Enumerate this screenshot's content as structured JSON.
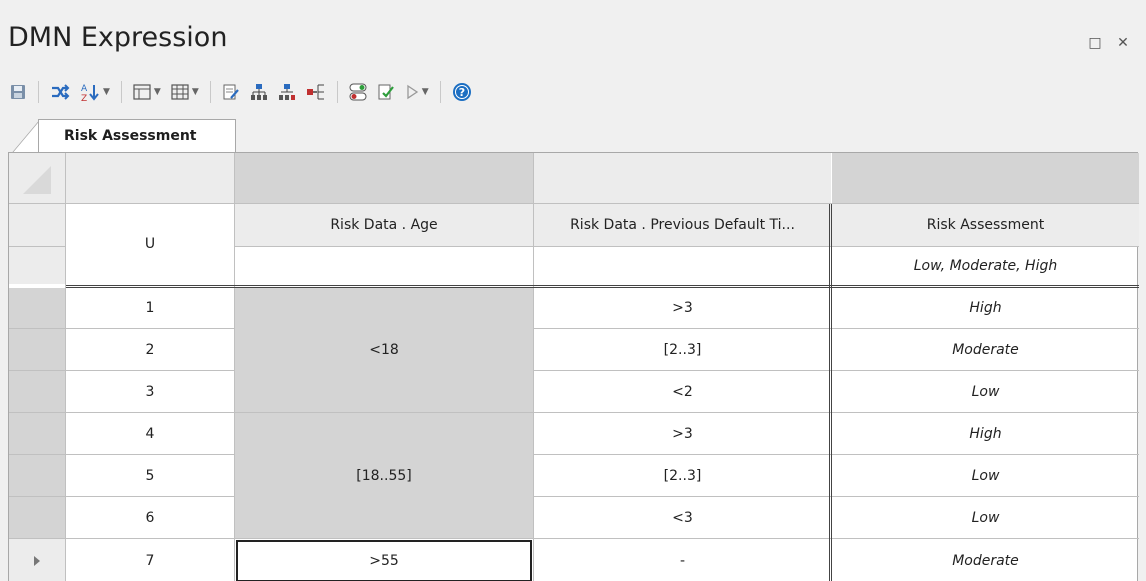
{
  "window": {
    "title": "DMN Expression"
  },
  "toolbar": {
    "buttons": [
      "save-icon",
      "shuffle-icon",
      "sort-az-icon",
      "table-layout-icon",
      "grid-layout-icon",
      "edit-doc-icon",
      "hierarchy-icon",
      "hierarchy-add-icon",
      "insert-column-icon",
      "toggle-icon",
      "validate-icon",
      "run-icon",
      "help-icon"
    ]
  },
  "tab": {
    "label": "Risk Assessment"
  },
  "table": {
    "hit_policy": "U",
    "inputs": [
      {
        "header": "Risk Data . Age",
        "allowed": ""
      },
      {
        "header": "Risk Data . Previous Default Ti...",
        "allowed": ""
      }
    ],
    "output": {
      "header": "Risk Assessment",
      "allowed": "Low, Moderate, High"
    },
    "rows": [
      {
        "n": "1",
        "out": "High",
        "in2": ">3"
      },
      {
        "n": "2",
        "out": "Moderate",
        "in2": "[2..3]"
      },
      {
        "n": "3",
        "out": "Low",
        "in2": "<2"
      },
      {
        "n": "4",
        "out": "High",
        "in2": ">3"
      },
      {
        "n": "5",
        "out": "Low",
        "in2": "[2..3]"
      },
      {
        "n": "6",
        "out": "Low",
        "in2": "<3"
      },
      {
        "n": "7",
        "out": "Moderate",
        "in2": "-"
      }
    ],
    "age_groups": [
      "<18",
      "[18..55]",
      ">55"
    ]
  },
  "colors": {
    "merged_cell": "#d4d4d4",
    "header": "#d4d4d4",
    "selector": "#d4d4d4"
  }
}
